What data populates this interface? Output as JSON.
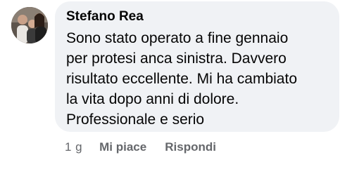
{
  "comment": {
    "author": "Stefano Rea",
    "text_lines": [
      "Sono stato operato a fine gennaio",
      "per protesi anca sinistra. Davvero",
      "risultato eccellente. Mi ha cambiato",
      "la vita dopo anni di dolore.",
      "Professionale e serio"
    ],
    "bubble_color": "#f0f2f5",
    "text_color": "#050505"
  },
  "actions": {
    "time": "1 g",
    "like_label": "Mi piace",
    "reply_label": "Rispondi",
    "color": "#65676b"
  },
  "avatar": {
    "icon": "user-photo-avatar"
  }
}
